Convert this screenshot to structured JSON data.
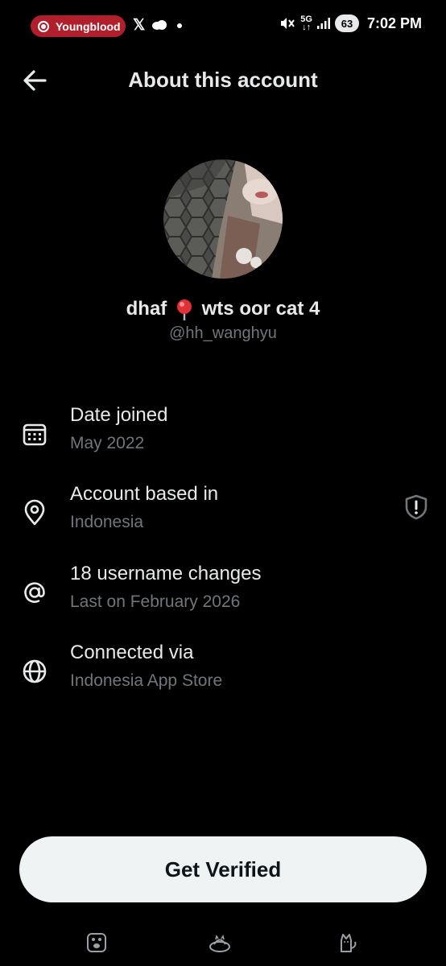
{
  "status_bar": {
    "recording_app": "Youngblood",
    "notification_icons": [
      "x-icon",
      "cloud-icon",
      "dot-icon"
    ],
    "network": "5G",
    "battery": "63",
    "time": "7:02 PM"
  },
  "header": {
    "title": "About this account"
  },
  "profile": {
    "display_name_part1": "dhaf",
    "display_name_emoji": "pin-icon",
    "display_name_part2": "wts oor cat 4",
    "handle": "@hh_wanghyu"
  },
  "details": [
    {
      "icon": "calendar-icon",
      "label": "Date joined",
      "value": "May 2022"
    },
    {
      "icon": "location-icon",
      "label": "Account based in",
      "value": "Indonesia",
      "badge": "shield-alert-icon"
    },
    {
      "icon": "at-icon",
      "label": "18 username changes",
      "value": "Last on February 2026"
    },
    {
      "icon": "globe-icon",
      "label": "Connected via",
      "value": "Indonesia App Store"
    }
  ],
  "cta": {
    "label": "Get Verified"
  },
  "colors": {
    "background": "#000000",
    "primary_text": "#e7e9ea",
    "secondary_text": "#71767b",
    "button_bg": "#eff3f4",
    "recording_pill": "#b21f2c"
  }
}
